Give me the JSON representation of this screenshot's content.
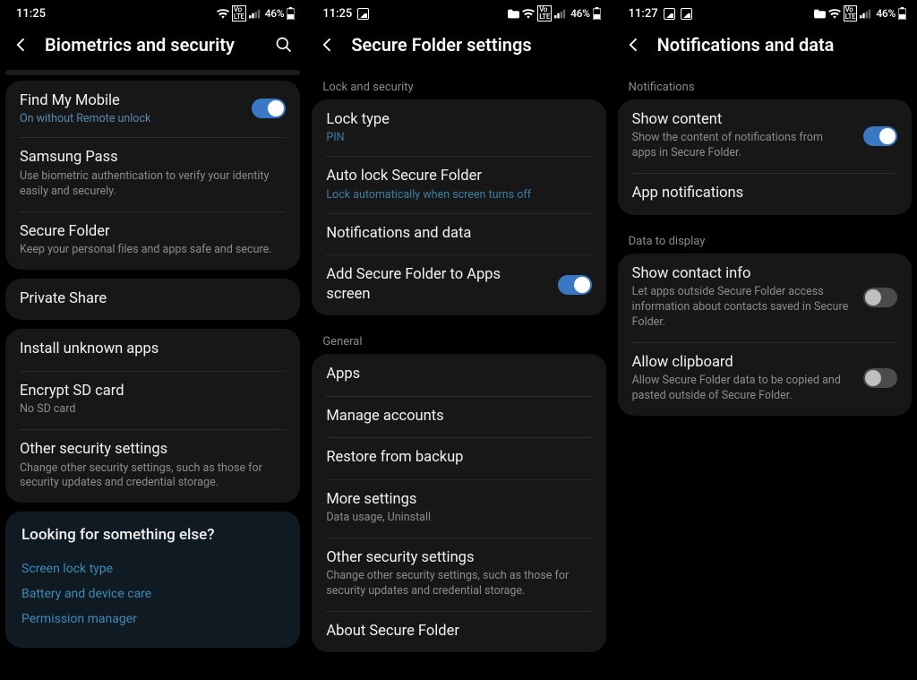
{
  "screens": [
    {
      "status": {
        "time": "11:25",
        "left_icons": [],
        "battery": "46%"
      },
      "header": {
        "title": "Biometrics and security",
        "has_search": true
      },
      "groups": [
        {
          "rows": [
            {
              "title": "Find My Mobile",
              "sub_accent": "On without Remote unlock",
              "toggle": "on"
            },
            {
              "title": "Samsung Pass",
              "sub": "Use biometric authentication to verify your identity easily and securely."
            },
            {
              "title": "Secure Folder",
              "sub": "Keep your personal files and apps safe and secure."
            }
          ]
        },
        {
          "rows": [
            {
              "title": "Private Share"
            }
          ]
        },
        {
          "rows": [
            {
              "title": "Install unknown apps"
            },
            {
              "title": "Encrypt SD card",
              "sub": "No SD card"
            },
            {
              "title": "Other security settings",
              "sub": "Change other security settings, such as those for security updates and credential storage."
            }
          ]
        }
      ],
      "suggest": {
        "heading": "Looking for something else?",
        "links": [
          "Screen lock type",
          "Battery and device care",
          "Permission manager"
        ]
      }
    },
    {
      "status": {
        "time": "11:25",
        "left_icons": [
          "pic"
        ],
        "right_icons": [
          "folder"
        ],
        "battery": "46%"
      },
      "header": {
        "title": "Secure Folder settings",
        "has_search": false
      },
      "categories": [
        {
          "label": "Lock and security",
          "rows": [
            {
              "title": "Lock type",
              "sub_accent": "PIN"
            },
            {
              "title": "Auto lock Secure Folder",
              "sub_accent": "Lock automatically when screen turns off"
            },
            {
              "title": "Notifications and data"
            },
            {
              "title": "Add Secure Folder to Apps screen",
              "toggle": "on"
            }
          ]
        },
        {
          "label": "General",
          "rows": [
            {
              "title": "Apps"
            },
            {
              "title": "Manage accounts"
            },
            {
              "title": "Restore from backup"
            },
            {
              "title": "More settings",
              "sub": "Data usage, Uninstall"
            },
            {
              "title": "Other security settings",
              "sub": "Change other security settings, such as those for security updates and credential storage."
            },
            {
              "title": "About Secure Folder"
            }
          ]
        }
      ]
    },
    {
      "status": {
        "time": "11:27",
        "left_icons": [
          "pic",
          "pic"
        ],
        "right_icons": [
          "folder"
        ],
        "battery": "46%"
      },
      "header": {
        "title": "Notifications and data",
        "has_search": false
      },
      "categories": [
        {
          "label": "Notifications",
          "rows": [
            {
              "title": "Show content",
              "sub": "Show the content of notifications from apps in Secure Folder.",
              "toggle": "on"
            },
            {
              "title": "App notifications"
            }
          ]
        },
        {
          "label": "Data to display",
          "rows": [
            {
              "title": "Show contact info",
              "sub": "Let apps outside Secure Folder access information about contacts saved in Secure Folder.",
              "toggle": "off"
            },
            {
              "title": "Allow clipboard",
              "sub": "Allow Secure Folder data to be copied and pasted outside of Secure Folder.",
              "toggle": "off"
            }
          ]
        }
      ]
    }
  ],
  "icons": {
    "wifi": "wifi",
    "volte": "VoLTE",
    "signal": "signal",
    "battery": "battery"
  }
}
